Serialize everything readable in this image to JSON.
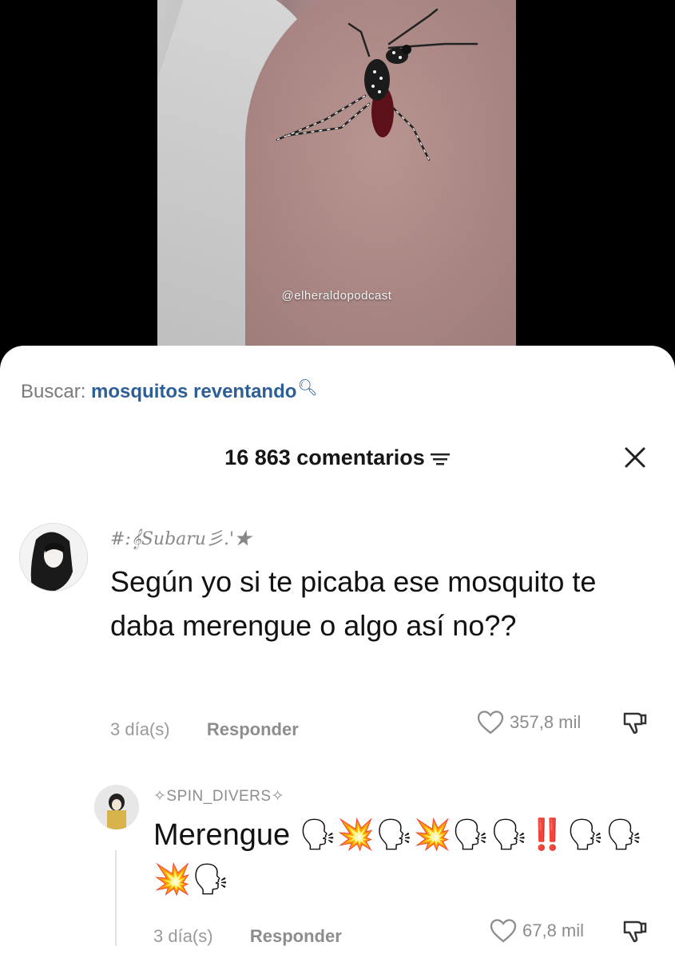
{
  "video": {
    "watermark": "@elheraldopodcast"
  },
  "search": {
    "prefix": "Buscar:",
    "query": "mosquitos reventando"
  },
  "comments_header": {
    "count_label": "16 863 comentarios"
  },
  "comments": [
    {
      "username": "#:𝄞Subaru彡.'★",
      "text": "Según yo si te picaba ese mosquito te daba merengue o algo así no??",
      "time": "3 día(s)",
      "reply_label": "Responder",
      "likes": "357,8 mil"
    },
    {
      "username": "✧SPIN_DIVERS✧",
      "text": "Merengue 🗣💥🗣💥🗣🗣‼️🗣🗣💥🗣",
      "time": "3 día(s)",
      "reply_label": "Responder",
      "likes": "67,8 mil"
    }
  ],
  "colors": {
    "link": "#2c5e98",
    "muted": "#8c8c8c",
    "sheet_bg": "#ffffff"
  }
}
